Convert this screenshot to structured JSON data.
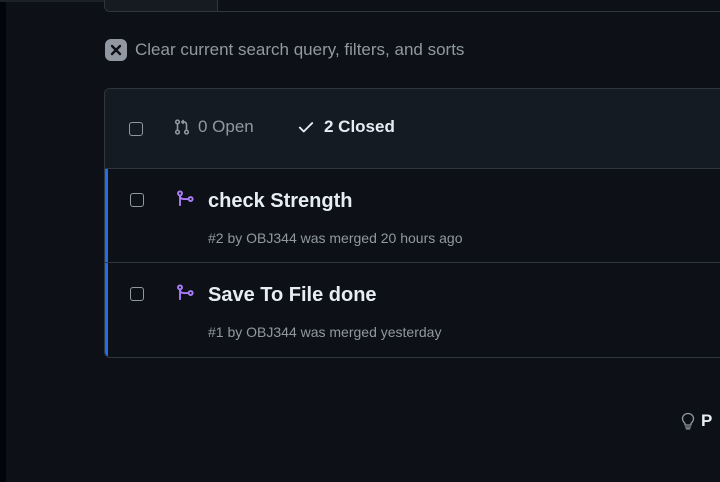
{
  "clear_filters": {
    "label": "Clear current search query, filters, and sorts",
    "icon": "x-icon"
  },
  "states": {
    "open_label": "0 Open",
    "closed_label": "2 Closed",
    "open_icon": "git-pull-request-icon",
    "closed_icon": "check-icon"
  },
  "pull_requests": [
    {
      "title": "check Strength",
      "meta": "#2 by OBJ344 was merged 20 hours ago",
      "icon": "git-merge-icon",
      "icon_color": "#ab7df8"
    },
    {
      "title": "Save To File done",
      "meta": "#1 by OBJ344 was merged yesterday",
      "icon": "git-merge-icon",
      "icon_color": "#ab7df8"
    }
  ],
  "protip": {
    "label": "P",
    "icon": "light-bulb-icon"
  },
  "colors": {
    "background": "#0d1117",
    "accent": "#1f6feb",
    "merged": "#ab7df8",
    "muted": "#9198a1",
    "border": "#30363d"
  }
}
